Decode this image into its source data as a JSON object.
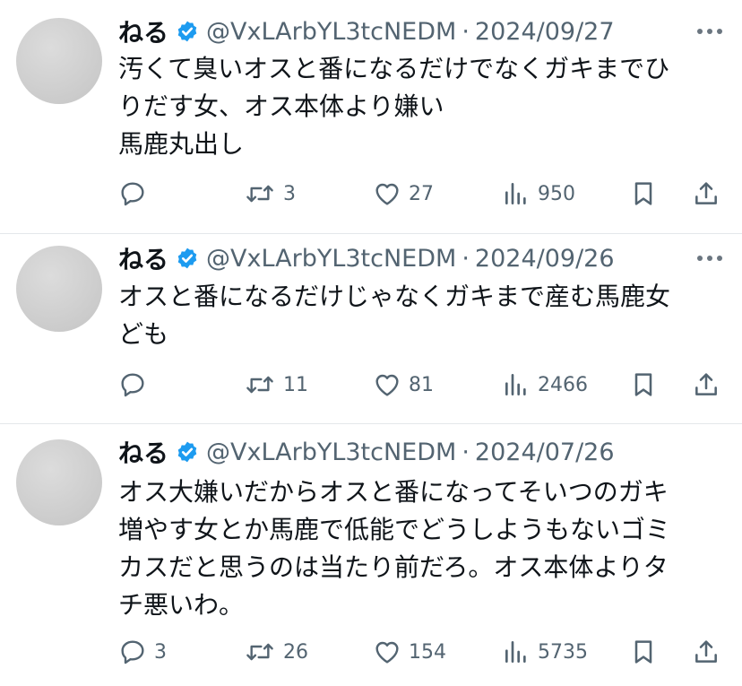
{
  "tweets": [
    {
      "name": "ねる",
      "handle": "@VxLArbYL3tcNEDM",
      "separator": "·",
      "date": "2024/09/27",
      "lines": [
        "汚くて臭いオスと番になるだけでなくガキまでひ",
        "りだす女、オス本体より嫌い",
        "馬鹿丸出し"
      ],
      "replies": "",
      "retweets": "3",
      "likes": "27",
      "views": "950"
    },
    {
      "name": "ねる",
      "handle": "@VxLArbYL3tcNEDM",
      "separator": "·",
      "date": "2024/09/26",
      "lines": [
        "オスと番になるだけじゃなくガキまで産む馬鹿女",
        "ども"
      ],
      "replies": "",
      "retweets": "11",
      "likes": "81",
      "views": "2466"
    },
    {
      "name": "ねる",
      "handle": "@VxLArbYL3tcNEDM",
      "separator": "·",
      "date": "2024/07/26",
      "lines": [
        "オス大嫌いだからオスと番になってそいつのガキ",
        "増やす女とか馬鹿で低能でどうしようもないゴミ",
        "カスだと思うのは当たり前だろ。オス本体よりタ",
        "チ悪いわ。"
      ],
      "replies": "3",
      "retweets": "26",
      "likes": "154",
      "views": "5735"
    }
  ],
  "icons": {
    "verified": "verified-badge-icon",
    "more": "more-dots-icon",
    "reply": "reply-bubble-icon",
    "retweet": "retweet-arrows-icon",
    "like": "heart-icon",
    "views": "views-bars-icon",
    "bookmark": "bookmark-icon",
    "share": "share-upload-icon"
  },
  "colors": {
    "text": "#0f1419",
    "secondary": "#536471",
    "verified": "#1d9bf0",
    "divider": "#e4e7ea"
  }
}
